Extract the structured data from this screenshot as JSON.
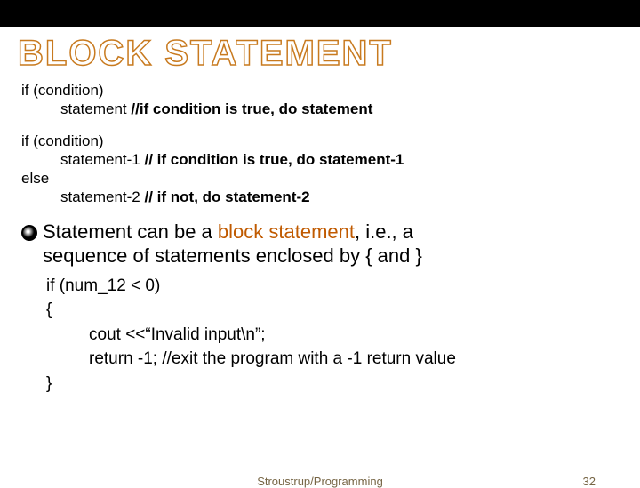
{
  "title": "BLOCK STATEMENT",
  "block1": {
    "l1": "if (condition)",
    "l2a": "statement   ",
    "l2b": "//if condition is true, do statement"
  },
  "block2": {
    "l1": "if (condition)",
    "l2a": "statement-1  ",
    "l2b": "// if condition is true, do statement-1",
    "l3": "else",
    "l4a": "statement-2 ",
    "l4b": "// if not, do statement-2"
  },
  "bullet": {
    "pre": "Statement can be a ",
    "accent": "block statement",
    "post1": ", i.e., a",
    "line2": "sequence of statements enclosed by { and }"
  },
  "code2": {
    "l1": "if (num_12 < 0)",
    "l2": "{",
    "l3": "cout <<“Invalid input\\n”;",
    "l4": "return -1;   //exit the program with a -1 return value",
    "l5": "}"
  },
  "footer": {
    "center": "Stroustrup/Programming",
    "pagenum": "32"
  }
}
